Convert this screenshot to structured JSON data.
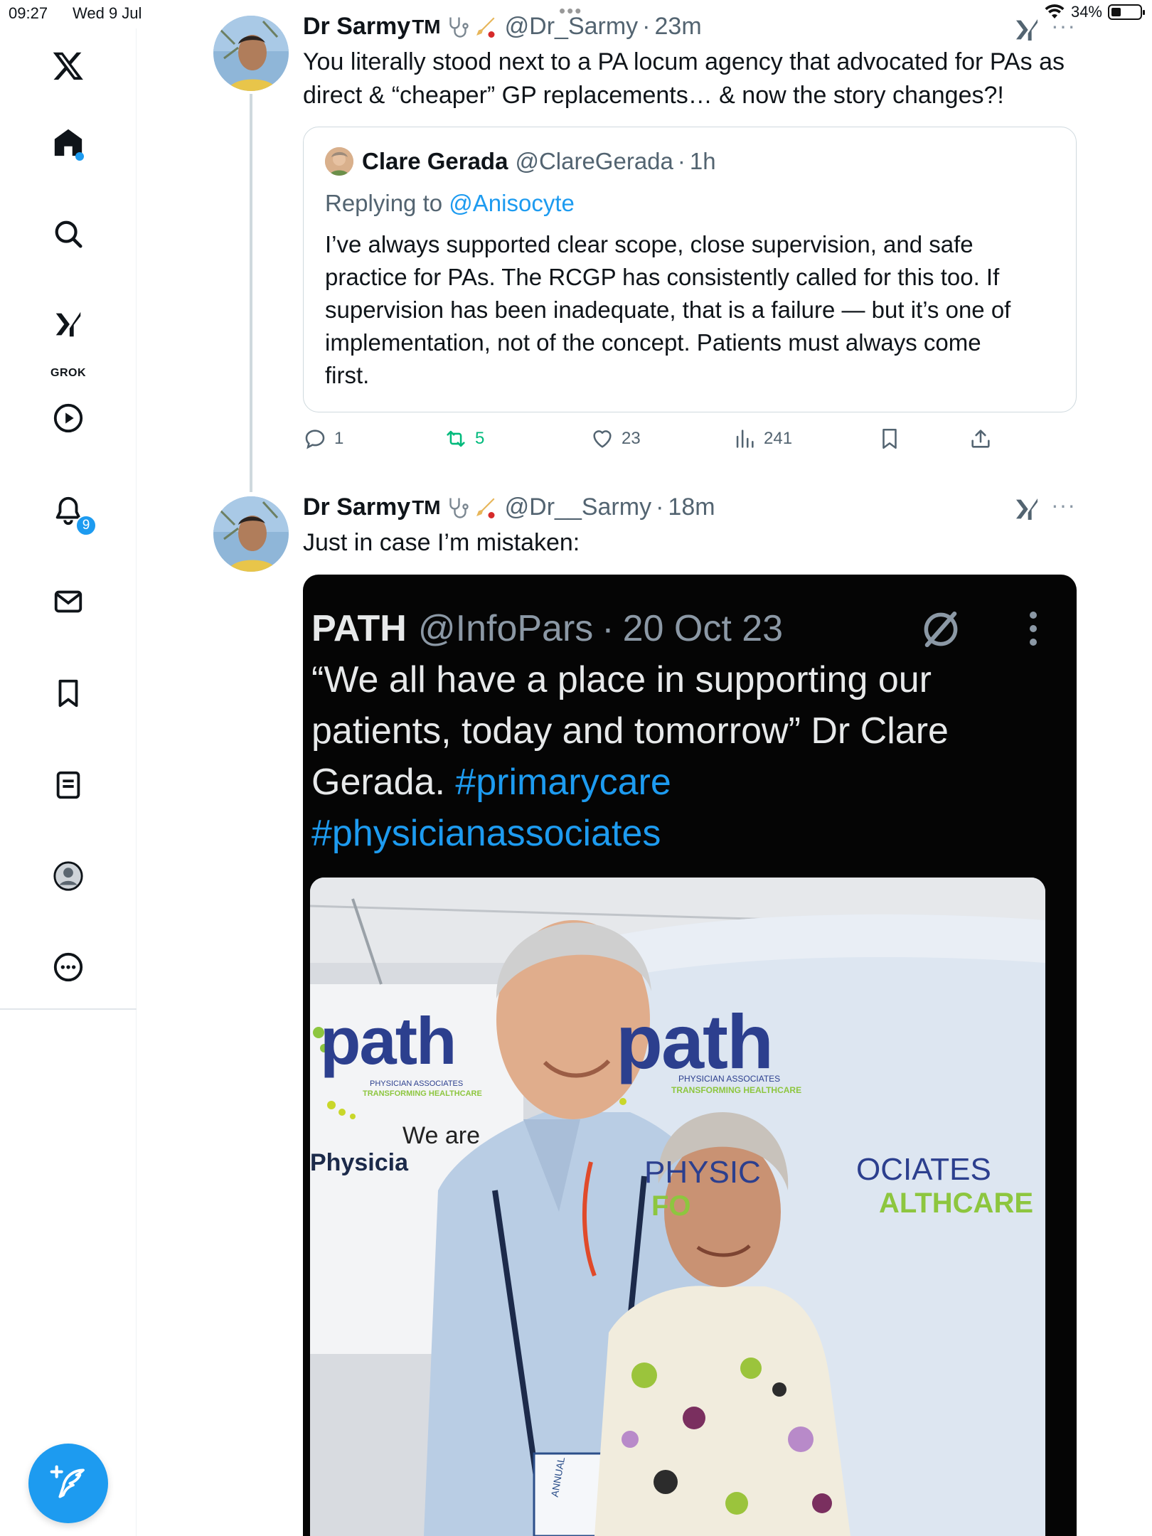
{
  "status_bar": {
    "time": "09:27",
    "date": "Wed 9 Jul",
    "battery": "34%",
    "battery_level": 0.34
  },
  "sidebar": {
    "items": [
      {
        "name": "x-logo-icon"
      },
      {
        "name": "home-icon",
        "has_dot": true
      },
      {
        "name": "search-icon"
      },
      {
        "name": "grok-icon",
        "label": "GROK"
      },
      {
        "name": "video-icon"
      },
      {
        "name": "notifications-icon",
        "badge": "9"
      },
      {
        "name": "messages-icon"
      },
      {
        "name": "bookmarks-icon"
      },
      {
        "name": "lists-icon"
      },
      {
        "name": "profile-icon"
      },
      {
        "name": "more-icon"
      }
    ],
    "compose_icon": "compose-icon"
  },
  "tweets": [
    {
      "author": "Dr Sarmy",
      "tm": "TM",
      "handle": "@Dr_Sarmy",
      "dot": "·",
      "time": "23m",
      "text_lines": [
        "You literally stood next to a PA locum agency that advocated for PAs as",
        "direct & “cheaper” GP replacements… & now the story changes?!"
      ],
      "quote": {
        "author": "Clare Gerada",
        "handle": "@ClareGerada",
        "dot": "·",
        "time": "1h",
        "replying_prefix": "Replying to",
        "replying_to": "@Anisocyte",
        "text_lines": [
          "I’ve always supported clear scope, close supervision, and safe",
          "practice for PAs. The RCGP has consistently called for this too. If",
          "supervision has been inadequate, that is a failure — but it’s one of",
          "implementation, not of the concept. Patients must always come",
          "first."
        ]
      },
      "actions": {
        "replies": "1",
        "reposts": "5",
        "likes": "23",
        "views": "241"
      }
    },
    {
      "author": "Dr Sarmy",
      "tm": "TM",
      "handle": "@Dr__Sarmy",
      "dot": "·",
      "time": "18m",
      "text": "Just in case I’m mistaken:",
      "media": {
        "author": "PATH",
        "handle": "@InfoPars",
        "dot": "·",
        "date": "20 Oct 23",
        "text_lines": [
          "“We all have a place in supporting our",
          "patients, today and tomorrow” Dr Clare"
        ],
        "text_line3": "Gerada.",
        "hashtag1": "#primarycare",
        "hashtag2": "#physicianassociates",
        "photo_text": {
          "path_left": "path",
          "path_right": "path",
          "sub_left_1": "PHYSICIAN ASSOCIATES",
          "sub_left_2": "TRANSFORMING HEALTHCARE",
          "sub_right_1": "PHYSICIAN ASSOCIATES",
          "sub_right_2": "TRANSFORMING HEALTHCARE",
          "we_are": "We are",
          "physicia": "Physicia",
          "banner_1a": "PHYSIC",
          "banner_1b": "OCIATES",
          "banner_2a": "FO",
          "banner_2b": "ALTHCARE",
          "lanyard": "ANNUAL"
        }
      }
    }
  ]
}
